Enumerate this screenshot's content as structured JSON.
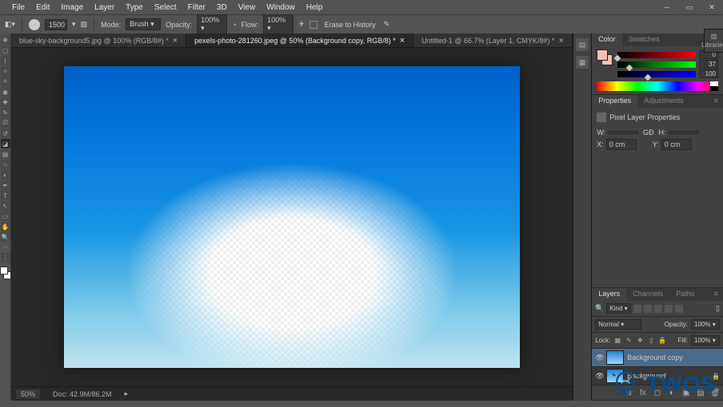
{
  "menu": {
    "items": [
      "File",
      "Edit",
      "Image",
      "Layer",
      "Type",
      "Select",
      "Filter",
      "3D",
      "View",
      "Window",
      "Help"
    ]
  },
  "options": {
    "brush_size": "1500",
    "mode_label": "Mode:",
    "mode_value": "Brush",
    "opacity_label": "Opacity:",
    "opacity_value": "100%",
    "flow_label": "Flow:",
    "flow_value": "100%",
    "erase_history_label": "Erase to History"
  },
  "tabs": [
    {
      "label": "blue-sky-background5.jpg @ 100% (RGB/8#) *"
    },
    {
      "label": "pexels-photo-281260.jpeg @ 50% (Background copy, RGB/8) *"
    },
    {
      "label": "Untitled-1 @ 66.7% (Layer 1, CMYK/8#) *"
    }
  ],
  "active_tab": 1,
  "status": {
    "zoom": "50%",
    "doc_info": "Doc: 42.9M/86.2M"
  },
  "color": {
    "tab1": "Color",
    "tab2": "Swatches",
    "r": 0,
    "g": 37,
    "b": 100
  },
  "properties": {
    "tab1": "Properties",
    "tab2": "Adjustments",
    "title": "Pixel Layer Properties",
    "w_label": "W:",
    "w_value": "",
    "h_label": "H:",
    "h_value": "",
    "x_label": "X:",
    "x_value": "0 cm",
    "y_label": "Y:",
    "y_value": "0 cm",
    "link_label": "GĐ"
  },
  "layers": {
    "tab1": "Layers",
    "tab2": "Channels",
    "tab3": "Paths",
    "kind_label": "Kind",
    "blend_mode": "Normal",
    "opacity_label": "Opacity:",
    "opacity_value": "100%",
    "lock_label": "Lock:",
    "fill_label": "Fill:",
    "fill_value": "100%",
    "items": [
      {
        "name": "Background copy",
        "selected": true,
        "visible": true,
        "locked": false
      },
      {
        "name": "Background",
        "selected": false,
        "visible": true,
        "locked": true
      }
    ]
  },
  "right_dock": {
    "label": "Libraries"
  },
  "watermark": "TWOS"
}
